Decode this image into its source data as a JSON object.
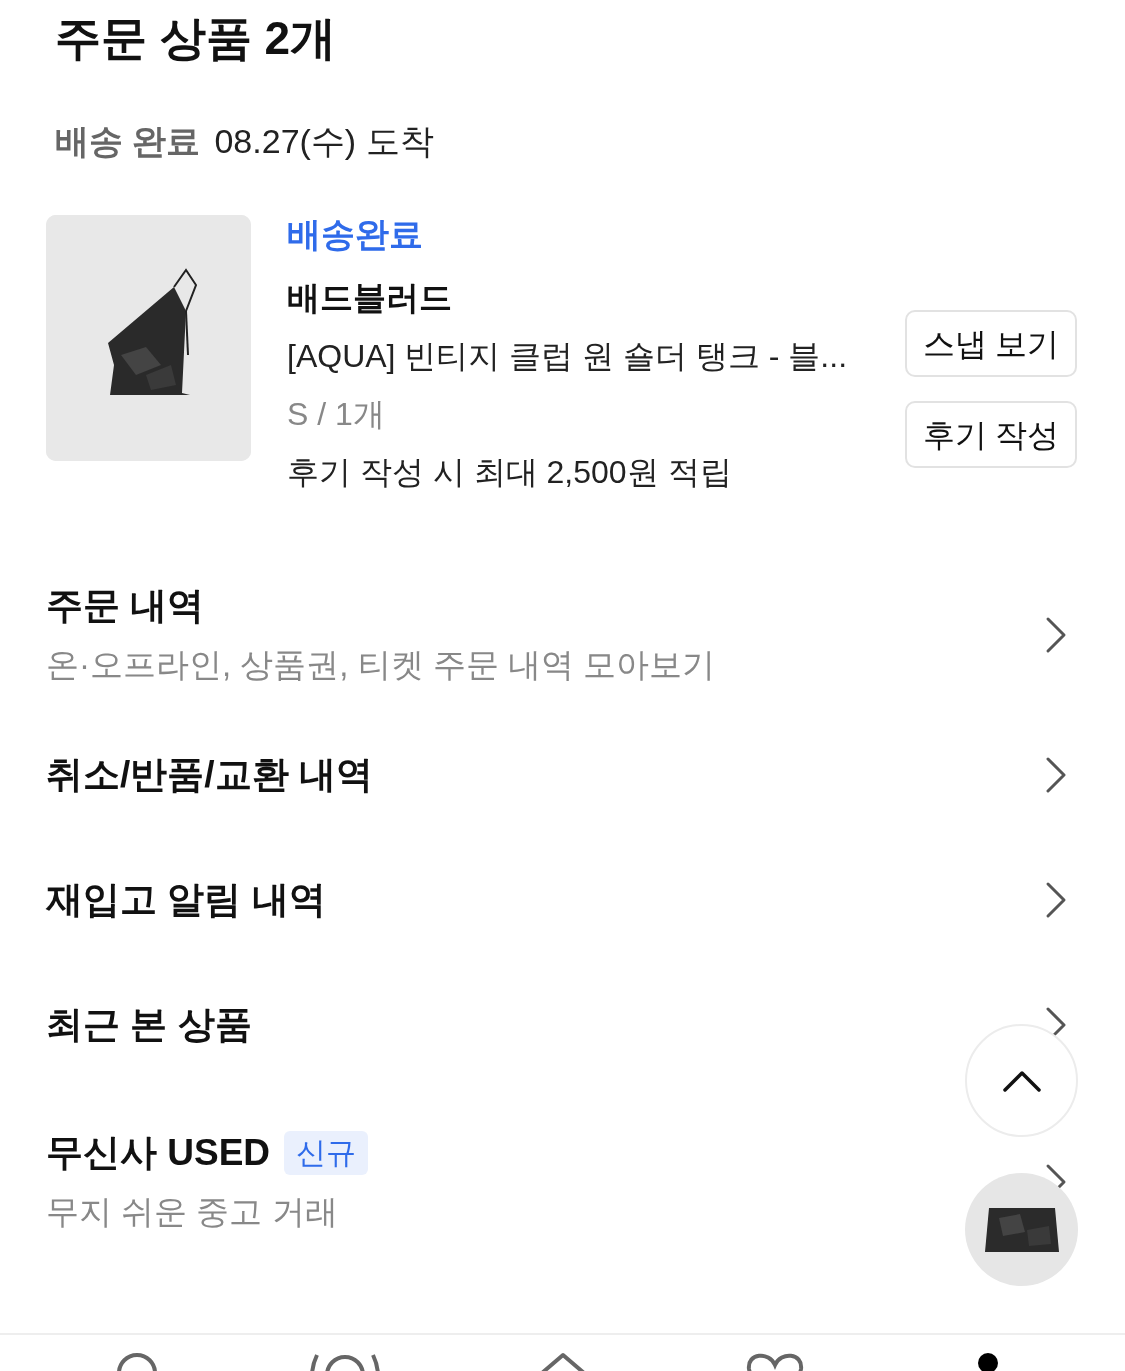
{
  "heading": "주문 상품 2개",
  "delivery": {
    "status": "배송 완료",
    "date": "08.27(수) 도착"
  },
  "product": {
    "status": "배송완료",
    "brand": "배드블러드",
    "name": "[AQUA] 빈티지 클럽 원 숄더 탱크 - 블...",
    "option": "S / 1개",
    "reward": "후기 작성 시 최대 2,500원 적립",
    "buttons": [
      "스냅 보기",
      "후기 작성"
    ]
  },
  "menu": [
    {
      "title": "주문 내역",
      "subtitle": "온·오프라인, 상품권, 티켓 주문 내역 모아보기"
    },
    {
      "title": "취소/반품/교환 내역"
    },
    {
      "title": "재입고 알림 내역"
    },
    {
      "title": "최근 본 상품"
    },
    {
      "title": "무신사 USED",
      "badge": "신규",
      "subtitle": "무지 쉬운 중고 거래"
    }
  ],
  "floating": {
    "scroll_top": true
  },
  "nav": [
    {
      "kind": "search",
      "selected": false
    },
    {
      "kind": "snap",
      "selected": false
    },
    {
      "kind": "home",
      "selected": false
    },
    {
      "kind": "heart",
      "selected": false
    },
    {
      "kind": "person",
      "selected": true
    }
  ]
}
